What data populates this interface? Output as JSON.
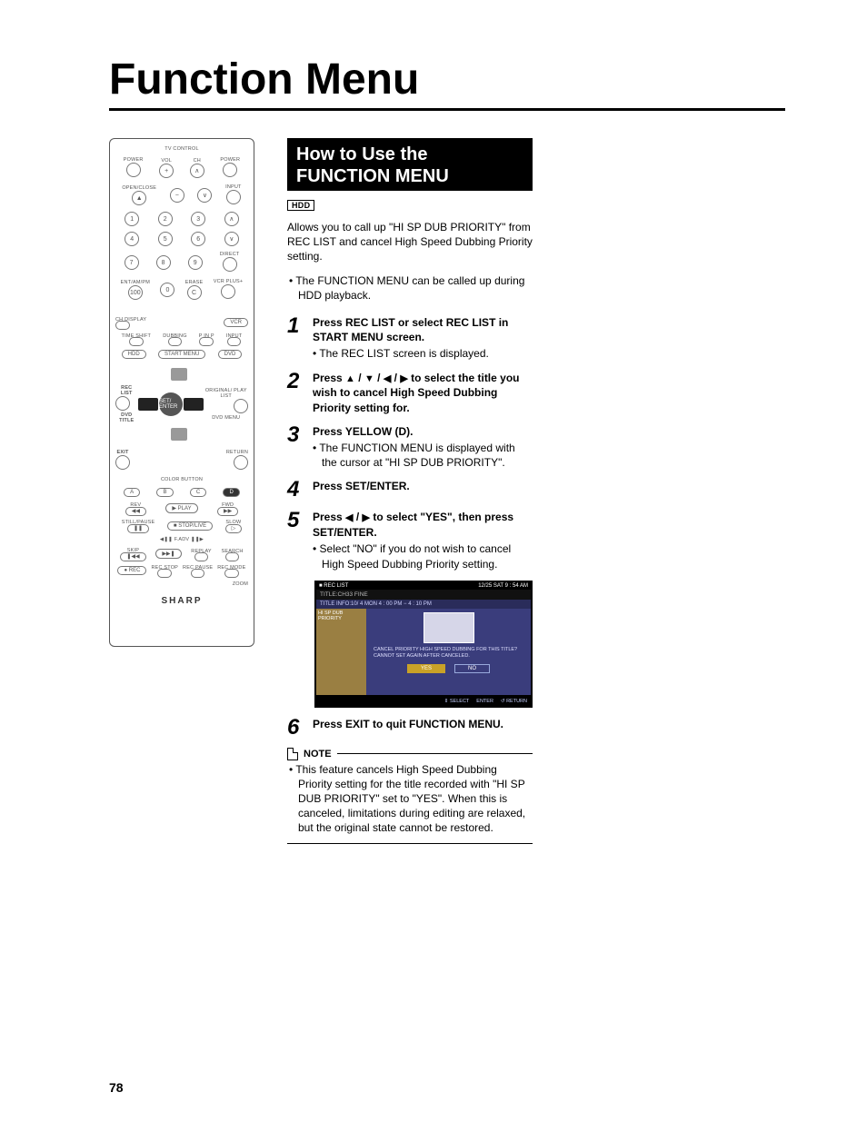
{
  "page_title": "Function Menu",
  "section_header_line1": "How to Use the",
  "section_header_line2": "FUNCTION MENU",
  "badge": "HDD",
  "intro_text": "Allows you to call up \"HI SP DUB PRIORITY\" from REC LIST and cancel High Speed Dubbing Priority setting.",
  "intro_bullet": "The FUNCTION MENU can be called up during HDD playback.",
  "steps": {
    "s1": {
      "num": "1",
      "lead": "Press REC LIST or select REC LIST in START MENU screen.",
      "sub": "The REC LIST screen is displayed."
    },
    "s2": {
      "num": "2",
      "lead_a": "Press ",
      "lead_b": " to select the title you wish to cancel High Speed Dubbing Priority setting for."
    },
    "s3": {
      "num": "3",
      "lead": "Press YELLOW (D).",
      "sub": "The FUNCTION MENU is displayed with the cursor at \"HI SP DUB PRIORITY\"."
    },
    "s4": {
      "num": "4",
      "lead": "Press SET/ENTER."
    },
    "s5": {
      "num": "5",
      "lead_a": "Press ",
      "lead_b": " to select \"YES\", then press SET/ENTER.",
      "sub": "Select \"NO\" if you do not wish to cancel High Speed Dubbing Priority setting."
    },
    "s6": {
      "num": "6",
      "lead": "Press EXIT to quit FUNCTION MENU."
    }
  },
  "osd": {
    "rec_list": "REC LIST",
    "datetime": "12/25  SAT   9 : 54  AM",
    "title_line": "TITLE:CH33  FINE",
    "info_line": "TITLE INFO:10/ 4 MON  4 : 00  PM  −  4 : 10  PM",
    "left_label": "HI SP DUB PRIORITY",
    "message": "CANCEL PRIORITY HIGH SPEED DUBBING FOR THIS TITLE?  CANNOT SET AGAIN AFTER CANCELED.",
    "yes": "YES",
    "no": "NO",
    "footer_select": "SELECT",
    "footer_enter": "ENTER",
    "footer_return": "RETURN"
  },
  "note_label": "NOTE",
  "note_text": "This feature cancels High Speed Dubbing Priority setting for the title recorded with \"HI SP DUB PRIORITY\" set to \"YES\". When this is canceled, limitations during editing are relaxed, but the original state cannot be restored.",
  "page_number": "78",
  "remote": {
    "tv_control": "TV CONTROL",
    "power": "POWER",
    "vol": "VOL",
    "ch": "CH",
    "open_close": "OPEN/CLOSE",
    "input": "INPUT",
    "direct": "DIRECT",
    "ent": "ENT/AM/PM",
    "erase": "ERASE",
    "vcrplus": "VCR PLUS+",
    "ch_display": "CH DISPLAY",
    "vcr": "VCR",
    "time_shift": "TIME SHIFT",
    "dubbing": "DUBBING",
    "pinp": "P IN P",
    "hdd": "HDD",
    "start_menu": "START MENU",
    "dvd": "DVD",
    "rec_list": "REC LIST",
    "dvd_title": "DVD TITLE",
    "original_playlist": "ORIGINAL/\nPLAY LIST",
    "dvd_menu": "DVD MENU",
    "set_enter": "SET/\nENTER",
    "exit": "EXIT",
    "return": "RETURN",
    "color_button": "COLOR BUTTON",
    "a": "A",
    "b": "B",
    "c": "C",
    "d": "D",
    "rev": "REV",
    "fwd": "FWD",
    "play": "PLAY",
    "still_pause": "STILL/PAUSE",
    "stop_live": "STOP/LIVE",
    "slow": "SLOW",
    "fadv": "F.ADV",
    "skip": "SKIP",
    "replay": "REPLAY",
    "search": "SEARCH",
    "rec": "REC",
    "rec_stop": "REC\nSTOP",
    "rec_pause": "REC\nPAUSE",
    "rec_mode": "REC\nMODE",
    "zoom": "ZOOM",
    "brand": "SHARP",
    "d1": "1",
    "d2": "2",
    "d3": "3",
    "d4": "4",
    "d5": "5",
    "d6": "6",
    "d7": "7",
    "d8": "8",
    "d9": "9",
    "d100": "100",
    "d0": "0",
    "dc": "C"
  }
}
